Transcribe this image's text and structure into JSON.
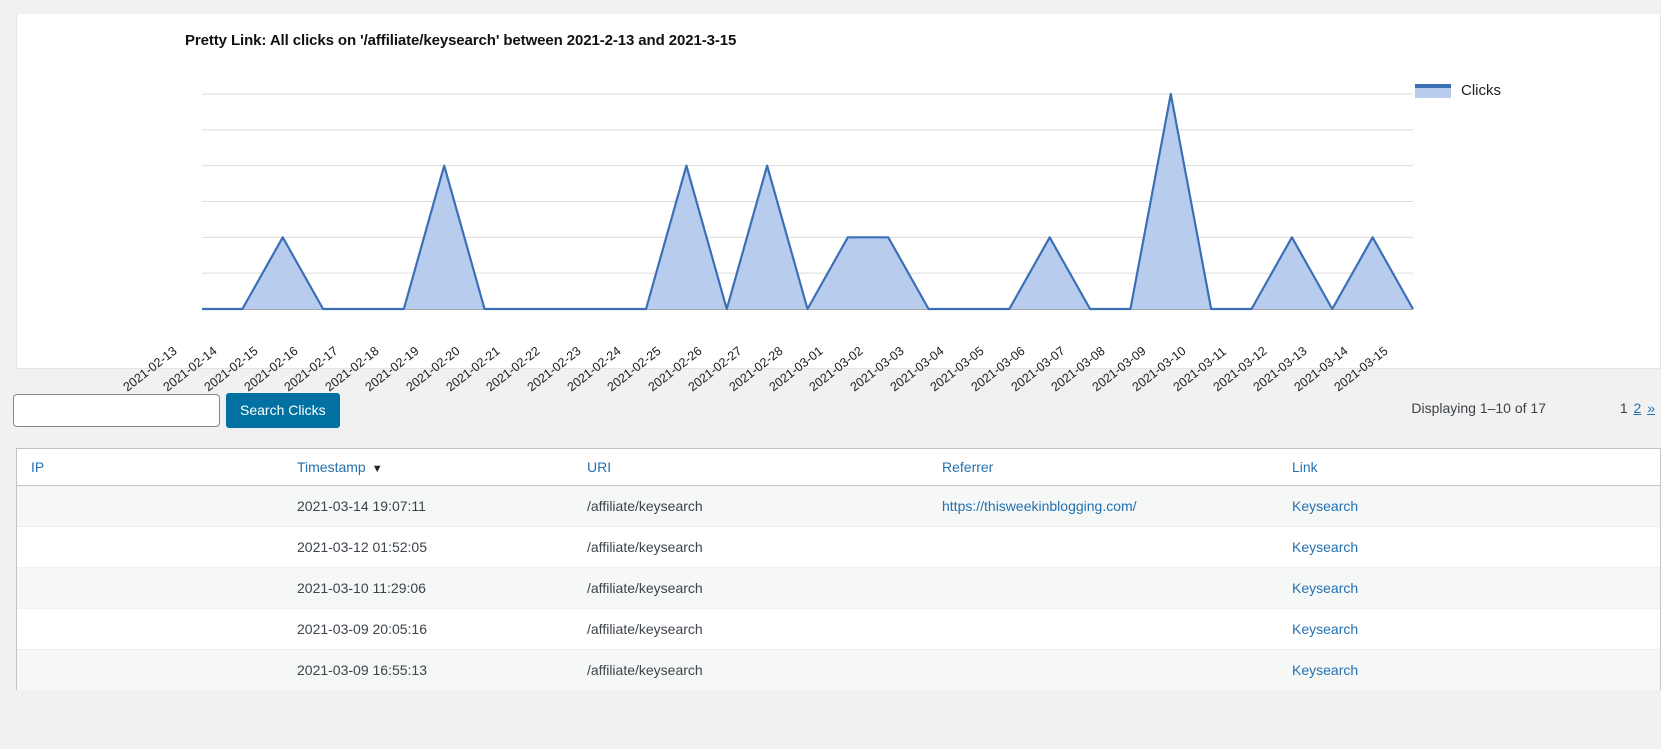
{
  "chart": {
    "title": "Pretty Link: All clicks on '/affiliate/keysearch' between 2021-2-13 and 2021-3-15",
    "legend_label": "Clicks",
    "line_color": "#3b6fb6",
    "fill_color": "#b8cdee"
  },
  "chart_data": {
    "type": "area",
    "title": "Pretty Link: All clicks on '/affiliate/keysearch' between 2021-2-13 and 2021-3-15",
    "xlabel": "",
    "ylabel": "",
    "ylim": [
      0,
      6
    ],
    "grid": true,
    "legend_position": "right",
    "categories": [
      "2021-02-13",
      "2021-02-14",
      "2021-02-15",
      "2021-02-16",
      "2021-02-17",
      "2021-02-18",
      "2021-02-19",
      "2021-02-20",
      "2021-02-21",
      "2021-02-22",
      "2021-02-23",
      "2021-02-24",
      "2021-02-25",
      "2021-02-26",
      "2021-02-27",
      "2021-02-28",
      "2021-03-01",
      "2021-03-02",
      "2021-03-03",
      "2021-03-04",
      "2021-03-05",
      "2021-03-06",
      "2021-03-07",
      "2021-03-08",
      "2021-03-09",
      "2021-03-10",
      "2021-03-11",
      "2021-03-12",
      "2021-03-13",
      "2021-03-14",
      "2021-03-15"
    ],
    "series": [
      {
        "name": "Clicks",
        "values": [
          0,
          0,
          2,
          0,
          0,
          0,
          4,
          0,
          0,
          0,
          0,
          0,
          4,
          0,
          4,
          0,
          2,
          2,
          0,
          0,
          0,
          2,
          0,
          0,
          6,
          0,
          0,
          2,
          0,
          2,
          0
        ]
      }
    ]
  },
  "search": {
    "value": "",
    "placeholder": "",
    "button_label": "Search Clicks"
  },
  "pagination": {
    "displaying": "Displaying 1–10 of 17",
    "page_1": "1",
    "page_2": "2",
    "next": "»"
  },
  "table": {
    "columns": [
      {
        "label": "IP",
        "sorted": false
      },
      {
        "label": "Timestamp",
        "sorted": true,
        "sort_arrow": "▼"
      },
      {
        "label": "URI",
        "sorted": false
      },
      {
        "label": "Referrer",
        "sorted": false
      },
      {
        "label": "Link",
        "sorted": false
      }
    ],
    "rows": [
      {
        "ip": "",
        "timestamp": "2021-03-14 19:07:11",
        "uri": "/affiliate/keysearch",
        "referrer": "https://thisweekinblogging.com/",
        "link": "Keysearch"
      },
      {
        "ip": "",
        "timestamp": "2021-03-12 01:52:05",
        "uri": "/affiliate/keysearch",
        "referrer": "",
        "link": "Keysearch"
      },
      {
        "ip": "",
        "timestamp": "2021-03-10 11:29:06",
        "uri": "/affiliate/keysearch",
        "referrer": "",
        "link": "Keysearch"
      },
      {
        "ip": "",
        "timestamp": "2021-03-09 20:05:16",
        "uri": "/affiliate/keysearch",
        "referrer": "",
        "link": "Keysearch"
      },
      {
        "ip": "",
        "timestamp": "2021-03-09 16:55:13",
        "uri": "/affiliate/keysearch",
        "referrer": "",
        "link": "Keysearch"
      }
    ]
  }
}
